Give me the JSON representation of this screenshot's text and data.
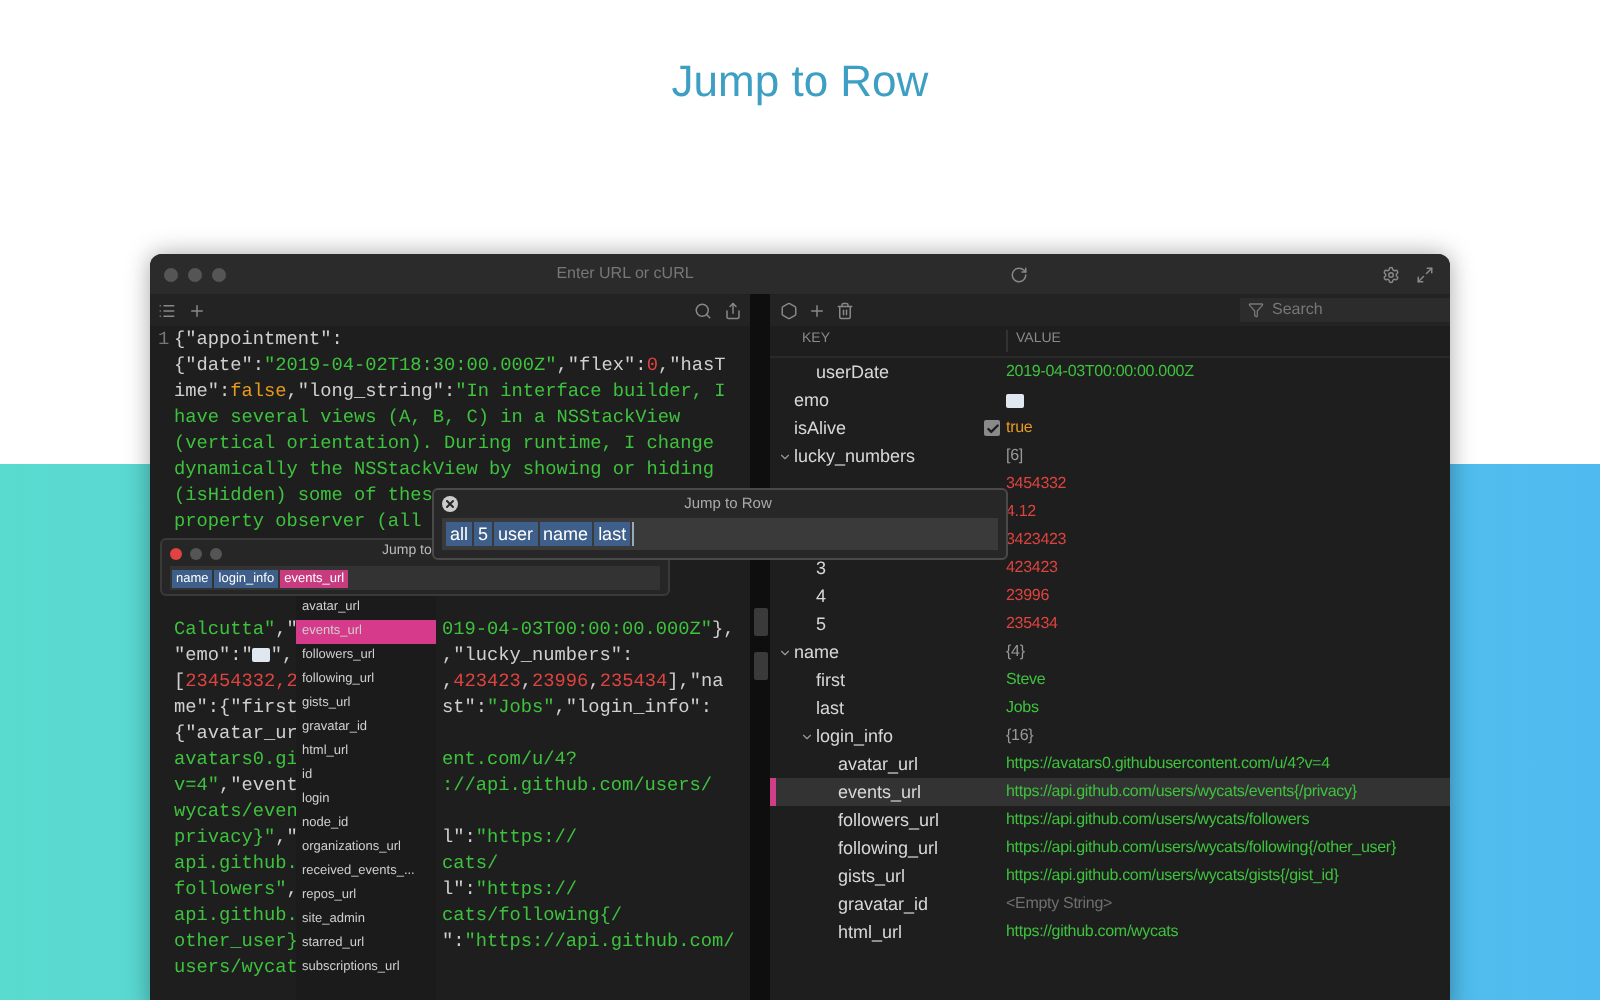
{
  "page_title": "Jump to Row",
  "window": {
    "url_placeholder": "Enter URL or cURL"
  },
  "editor": {
    "lines": [
      {
        "number": "1",
        "segs": [
          {
            "text": "{\"appointment\":",
            "kind": "plain"
          }
        ]
      },
      {
        "segs": [
          {
            "text": "{\"date\":",
            "kind": "plain"
          },
          {
            "text": "\"2019-04-02T18:30:00.000Z\"",
            "kind": "str"
          },
          {
            "text": ",\"flex\":",
            "kind": "plain"
          },
          {
            "text": "0",
            "kind": "num"
          },
          {
            "text": ",\"hasT",
            "kind": "plain"
          }
        ]
      },
      {
        "segs": [
          {
            "text": "ime\":",
            "kind": "plain"
          },
          {
            "text": "false",
            "kind": "bool"
          },
          {
            "text": ",\"long_string\":",
            "kind": "plain"
          },
          {
            "text": "\"In interface builder, I",
            "kind": "str"
          }
        ]
      },
      {
        "segs": [
          {
            "text": "have several views (A, B, C) in a NSStackView",
            "kind": "str"
          }
        ]
      },
      {
        "segs": [
          {
            "text": "(vertical orientation). During runtime, I change",
            "kind": "str"
          }
        ]
      },
      {
        "segs": [
          {
            "text": "dynamically the NSStackView by showing or hiding",
            "kind": "str"
          }
        ]
      },
      {
        "segs": [
          {
            "text": "(isHidden) some of thes",
            "kind": "str"
          }
        ]
      },
      {
        "segs": [
          {
            "text": "property observer (all",
            "kind": "str"
          }
        ]
      }
    ],
    "split_lines": [
      {
        "left": [
          {
            "text": "Calcutta\"",
            "kind": "str"
          },
          {
            "text": ",\"",
            "kind": "plain"
          }
        ],
        "right": [
          {
            "text": "019-04-03T00:00:00.000Z\"",
            "kind": "str"
          },
          {
            "text": "},",
            "kind": "plain"
          }
        ]
      },
      {
        "left": [
          {
            "text": "\"emo\":\"",
            "kind": "plain"
          },
          {
            "kind": "emoji"
          },
          {
            "text": "\",",
            "kind": "plain"
          }
        ],
        "right": [
          {
            "text": ",\"lucky_numbers\":",
            "kind": "plain"
          }
        ]
      },
      {
        "left": [
          {
            "text": "[",
            "kind": "plain"
          },
          {
            "text": "23454332",
            "kind": "num"
          },
          {
            "text": ",2",
            "kind": "num"
          }
        ],
        "right": [
          {
            "text": ",",
            "kind": "plain"
          },
          {
            "text": "423423",
            "kind": "num"
          },
          {
            "text": ",",
            "kind": "plain"
          },
          {
            "text": "23996",
            "kind": "num"
          },
          {
            "text": ",",
            "kind": "plain"
          },
          {
            "text": "235434",
            "kind": "num"
          },
          {
            "text": "],\"na",
            "kind": "plain"
          }
        ]
      },
      {
        "left": [
          {
            "text": "me\":{\"first",
            "kind": "plain"
          }
        ],
        "right": [
          {
            "text": "st\":",
            "kind": "plain"
          },
          {
            "text": "\"Jobs\"",
            "kind": "str"
          },
          {
            "text": ",\"login_info\":",
            "kind": "plain"
          }
        ]
      },
      {
        "left": [
          {
            "text": "{\"avatar_ur",
            "kind": "plain"
          }
        ]
      },
      {
        "left": [
          {
            "text": "avatars0.gi",
            "kind": "str"
          }
        ],
        "right": [
          {
            "text": "ent.com/u/4?",
            "kind": "str"
          }
        ]
      },
      {
        "left": [
          {
            "text": "v=4\"",
            "kind": "str"
          },
          {
            "text": ",\"event",
            "kind": "plain"
          }
        ],
        "right": [
          {
            "text": "://api.github.com/users/",
            "kind": "str"
          }
        ]
      },
      {
        "left": [
          {
            "text": "wycats/even",
            "kind": "str"
          }
        ]
      },
      {
        "left": [
          {
            "text": "privacy}\"",
            "kind": "str"
          },
          {
            "text": ",\"",
            "kind": "plain"
          }
        ],
        "right": [
          {
            "text": "l\":",
            "kind": "plain"
          },
          {
            "text": "\"https://",
            "kind": "str"
          }
        ]
      },
      {
        "left": [
          {
            "text": "api.github.",
            "kind": "str"
          }
        ],
        "right": [
          {
            "text": "cats/",
            "kind": "str"
          }
        ]
      },
      {
        "left": [
          {
            "text": "followers\"",
            "kind": "str"
          },
          {
            "text": ",",
            "kind": "plain"
          }
        ],
        "right": [
          {
            "text": "l\":",
            "kind": "plain"
          },
          {
            "text": "\"https://",
            "kind": "str"
          }
        ]
      },
      {
        "left": [
          {
            "text": "api.github.",
            "kind": "str"
          }
        ],
        "right": [
          {
            "text": "cats/following{/",
            "kind": "str"
          }
        ]
      },
      {
        "left": [
          {
            "text": "other_user}",
            "kind": "str"
          }
        ],
        "right": [
          {
            "text": "\":",
            "kind": "plain"
          },
          {
            "text": "\"https://api.github.com/",
            "kind": "str"
          }
        ]
      },
      {
        "left": [
          {
            "text": "users/wycat",
            "kind": "str"
          }
        ]
      }
    ]
  },
  "tree": {
    "search_placeholder": "Search",
    "columns": [
      "KEY",
      "VALUE"
    ],
    "continued": [
      {
        "key": "userDate",
        "value": "2019-04-03T00:00:00.000Z",
        "kind": "str",
        "selected": false
      }
    ],
    "rows": [
      {
        "key": "emo",
        "kind": "emoji",
        "selected": false
      },
      {
        "key": "isAlive",
        "value": "true",
        "kind": "bool",
        "checked": true,
        "selected": false
      },
      {
        "key": "lucky_numbers",
        "value": "[6]",
        "kind": "count",
        "expanded": true,
        "selected": false,
        "children": [
          {
            "value": "3454332",
            "kind": "num",
            "selected": false
          },
          {
            "value": "4.12",
            "kind": "num",
            "selected": false
          },
          {
            "value": "3423423",
            "kind": "num",
            "selected": false
          },
          {
            "key": "3",
            "value": "423423",
            "kind": "num",
            "selected": false
          },
          {
            "key": "4",
            "value": "23996",
            "kind": "num",
            "selected": false
          },
          {
            "key": "5",
            "value": "235434",
            "kind": "num",
            "selected": false
          }
        ]
      },
      {
        "key": "name",
        "value": "{4}",
        "kind": "count",
        "expanded": true,
        "selected": false,
        "children": [
          {
            "key": "first",
            "value": "Steve",
            "kind": "str",
            "selected": false
          },
          {
            "key": "last",
            "value": "Jobs",
            "kind": "str",
            "selected": false
          },
          {
            "key": "login_info",
            "value": "{16}",
            "kind": "count",
            "expanded": true,
            "selected": false,
            "children": [
              {
                "key": "avatar_url",
                "value": "https://avatars0.githubusercontent.com/u/4?v=4",
                "kind": "str",
                "selected": false
              },
              {
                "key": "events_url",
                "value": "https://api.github.com/users/wycats/events{/privacy}",
                "kind": "str",
                "selected": true
              },
              {
                "key": "followers_url",
                "value": "https://api.github.com/users/wycats/followers",
                "kind": "str",
                "selected": false
              },
              {
                "key": "following_url",
                "value": "https://api.github.com/users/wycats/following{/other_user}",
                "kind": "str",
                "selected": false
              },
              {
                "key": "gists_url",
                "value": "https://api.github.com/users/wycats/gists{/gist_id}",
                "kind": "str",
                "selected": false
              },
              {
                "key": "gravatar_id",
                "value": "<Empty String>",
                "kind": "empty",
                "selected": false
              },
              {
                "key": "html_url",
                "value": "https://github.com/wycats",
                "kind": "str",
                "selected": false
              }
            ]
          }
        ]
      }
    ]
  },
  "small_window": {
    "title": "Jump to",
    "path": [
      {
        "label": "name",
        "selected": false
      },
      {
        "label": "login_info",
        "selected": false
      },
      {
        "label": "events_url",
        "selected": true
      }
    ],
    "suggestions": [
      {
        "label": "avatar_url",
        "selected": false
      },
      {
        "label": "events_url",
        "selected": true
      },
      {
        "label": "followers_url",
        "selected": false
      },
      {
        "label": "following_url",
        "selected": false
      },
      {
        "label": "gists_url",
        "selected": false
      },
      {
        "label": "gravatar_id",
        "selected": false
      },
      {
        "label": "html_url",
        "selected": false
      },
      {
        "label": "id",
        "selected": false
      },
      {
        "label": "login",
        "selected": false
      },
      {
        "label": "node_id",
        "selected": false
      },
      {
        "label": "organizations_url",
        "selected": false
      },
      {
        "label": "received_events_...",
        "selected": false
      },
      {
        "label": "repos_url",
        "selected": false
      },
      {
        "label": "site_admin",
        "selected": false
      },
      {
        "label": "starred_url",
        "selected": false
      },
      {
        "label": "subscriptions_url",
        "selected": false
      }
    ]
  },
  "dialog": {
    "title": "Jump to Row",
    "tokens": [
      "all",
      "5",
      "user",
      "name",
      "last"
    ]
  }
}
